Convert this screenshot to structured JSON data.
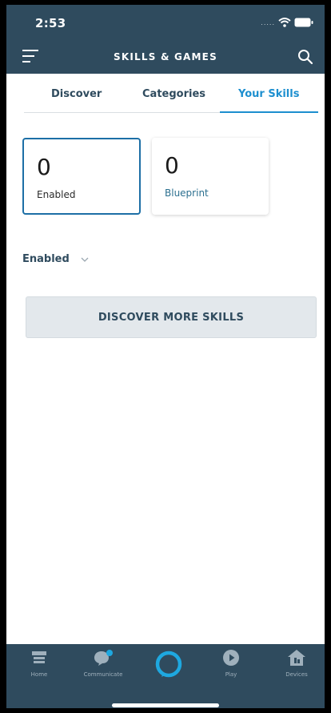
{
  "status": {
    "time": "2:53",
    "signal": "....."
  },
  "header": {
    "title": "SKILLS & GAMES"
  },
  "tabs": [
    {
      "label": "Discover"
    },
    {
      "label": "Categories"
    },
    {
      "label": "Your Skills",
      "active": true
    }
  ],
  "cards": [
    {
      "value": "0",
      "label": "Enabled",
      "selected": true
    },
    {
      "value": "0",
      "label": "Blueprint",
      "selected": false
    }
  ],
  "filter": {
    "label": "Enabled"
  },
  "discover_button": {
    "label": "DISCOVER MORE SKILLS"
  },
  "bottom_nav": [
    {
      "label": "Home",
      "icon": "home-icon"
    },
    {
      "label": "Communicate",
      "icon": "communicate-icon"
    },
    {
      "label": "",
      "icon": "alexa-icon"
    },
    {
      "label": "Play",
      "icon": "play-icon"
    },
    {
      "label": "Devices",
      "icon": "devices-icon"
    }
  ],
  "colors": {
    "header": "#2f4b5e",
    "accent": "#1d8fcf",
    "alexa": "#1ea8e0"
  }
}
